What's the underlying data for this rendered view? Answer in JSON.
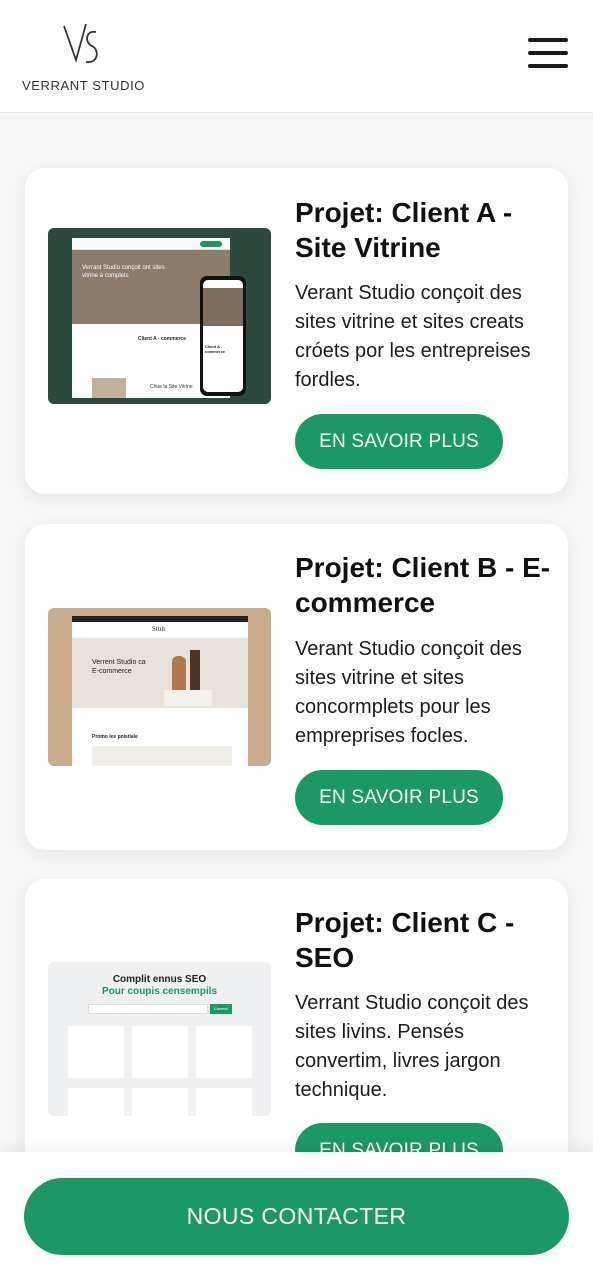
{
  "header": {
    "logo_monogram": "VS",
    "brand_name": "VERRANT STUDIO",
    "menu_icon": "hamburger-menu-icon"
  },
  "projects": [
    {
      "title": "Projet: Client A - Site Vitrine",
      "description": "Verant Studio conçoit des sites vitrine et sites creats cróets por les entrepreises fordles.",
      "cta_label": "EN SAVOIR PLUS",
      "preview": {
        "hero_text": "Verrant Studio conçoit ont sites vitrine à complets",
        "section_title": "Client A - commerce",
        "phone_title": "Client A - commerce",
        "sub_title": "Chue la Site Vitrine"
      }
    },
    {
      "title": "Projet: Client B - E-commerce",
      "description": "Verant Studio conçoit des sites vitrine et sites concormplets pour les empreprises focles.",
      "cta_label": "EN SAVOIR PLUS",
      "preview": {
        "hero_text": "Verrent Studio ca E-commerce",
        "brand": "Stuit",
        "products_title": "Promo les pnistiale"
      }
    },
    {
      "title": "Projet: Client C - SEO",
      "description": "Verrant Studio conçoit des sites livins. Pensés convertim, livres jargon technique.",
      "cta_label": "EN SAVOIR PLUS",
      "preview": {
        "heading": "Complit ennus SEO",
        "subheading": "Pour coupis censempils",
        "search_button": "Commit"
      }
    }
  ],
  "footer": {
    "contact_label": "NOUS CONTACTER"
  },
  "colors": {
    "accent": "#1a9a62",
    "dark_green": "#2d4a3e",
    "beige": "#c9ab8e",
    "background": "#f6f6f6"
  }
}
